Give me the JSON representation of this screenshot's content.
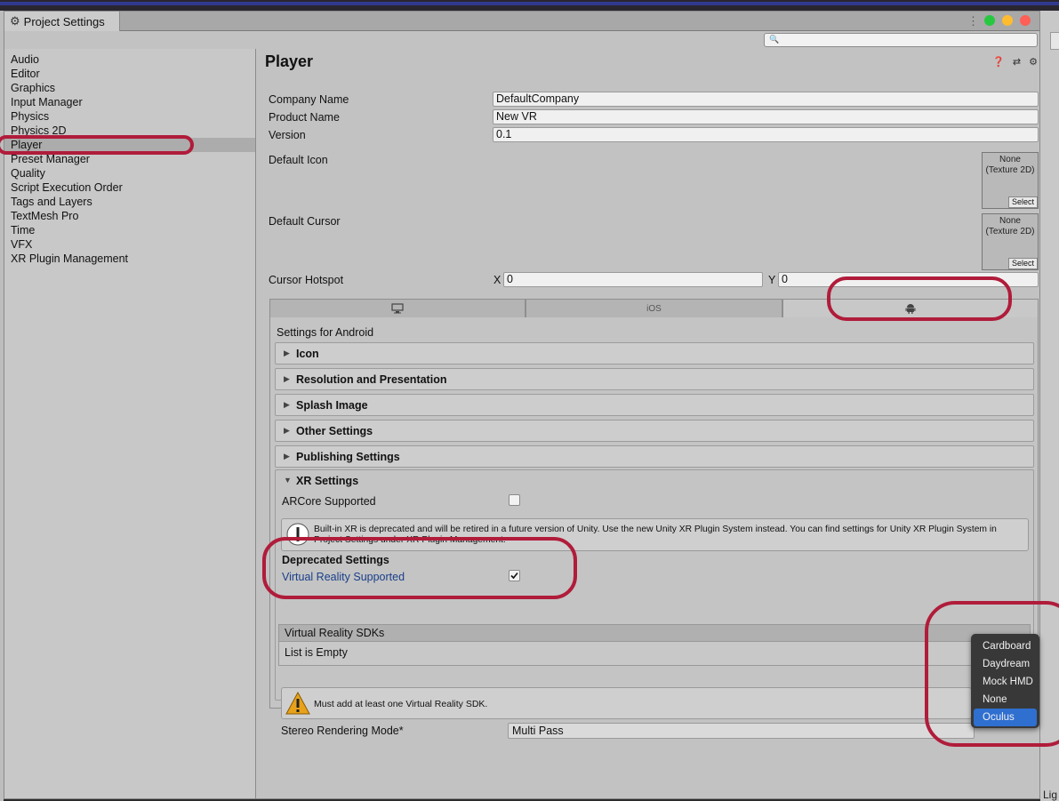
{
  "window": {
    "title": "Project Settings"
  },
  "search": {
    "placeholder": ""
  },
  "sidebar": {
    "items": [
      {
        "label": "Audio"
      },
      {
        "label": "Editor"
      },
      {
        "label": "Graphics"
      },
      {
        "label": "Input Manager"
      },
      {
        "label": "Physics"
      },
      {
        "label": "Physics 2D"
      },
      {
        "label": "Player"
      },
      {
        "label": "Preset Manager"
      },
      {
        "label": "Quality"
      },
      {
        "label": "Script Execution Order"
      },
      {
        "label": "Tags and Layers"
      },
      {
        "label": "TextMesh Pro"
      },
      {
        "label": "Time"
      },
      {
        "label": "VFX"
      },
      {
        "label": "XR Plugin Management"
      }
    ],
    "selected": "Player"
  },
  "player": {
    "title": "Player",
    "company_label": "Company Name",
    "company_value": "DefaultCompany",
    "product_label": "Product Name",
    "product_value": "New VR",
    "version_label": "Version",
    "version_value": "0.1",
    "default_icon_label": "Default Icon",
    "default_cursor_label": "Default Cursor",
    "texture_none": "None\n(Texture 2D)",
    "select_label": "Select",
    "hotspot_label": "Cursor Hotspot",
    "hotspot_x_label": "X",
    "hotspot_x": "0",
    "hotspot_y_label": "Y",
    "hotspot_y": "0"
  },
  "platform_tabs": [
    {
      "label": "",
      "icon": "monitor-icon"
    },
    {
      "label": "iOS",
      "icon": ""
    },
    {
      "label": "",
      "icon": "android-icon",
      "active": true
    }
  ],
  "android": {
    "settings_for": "Settings for Android",
    "sections": [
      "Icon",
      "Resolution and Presentation",
      "Splash Image",
      "Other Settings",
      "Publishing Settings"
    ],
    "xr_title": "XR Settings",
    "arcore_label": "ARCore Supported",
    "xr_deprecated_msg": "Built-in XR is deprecated and will be retired in a future version of Unity. Use the new Unity XR Plugin System instead. You can find settings for Unity XR Plugin System in Project Settings under XR Plugin Management.",
    "deprecated_heading": "Deprecated Settings",
    "vr_supported_label": "Virtual Reality Supported",
    "vr_sdks_label": "Virtual Reality SDKs",
    "list_empty": "List is Empty",
    "plus": "+",
    "minus": "−",
    "warning_msg": "Must add at least one Virtual Reality SDK.",
    "stereo_label": "Stereo Rendering Mode*",
    "stereo_value": "Multi Pass"
  },
  "sdk_popup": {
    "options": [
      "Cardboard",
      "Daydream",
      "Mock HMD",
      "None",
      "Oculus"
    ],
    "highlighted": "Oculus"
  },
  "right_edge_text": "Lig",
  "colors": {
    "highlight_ring": "#b01c3a",
    "selection_blue": "#2f6fd0",
    "link_blue": "#1a3f8a"
  }
}
